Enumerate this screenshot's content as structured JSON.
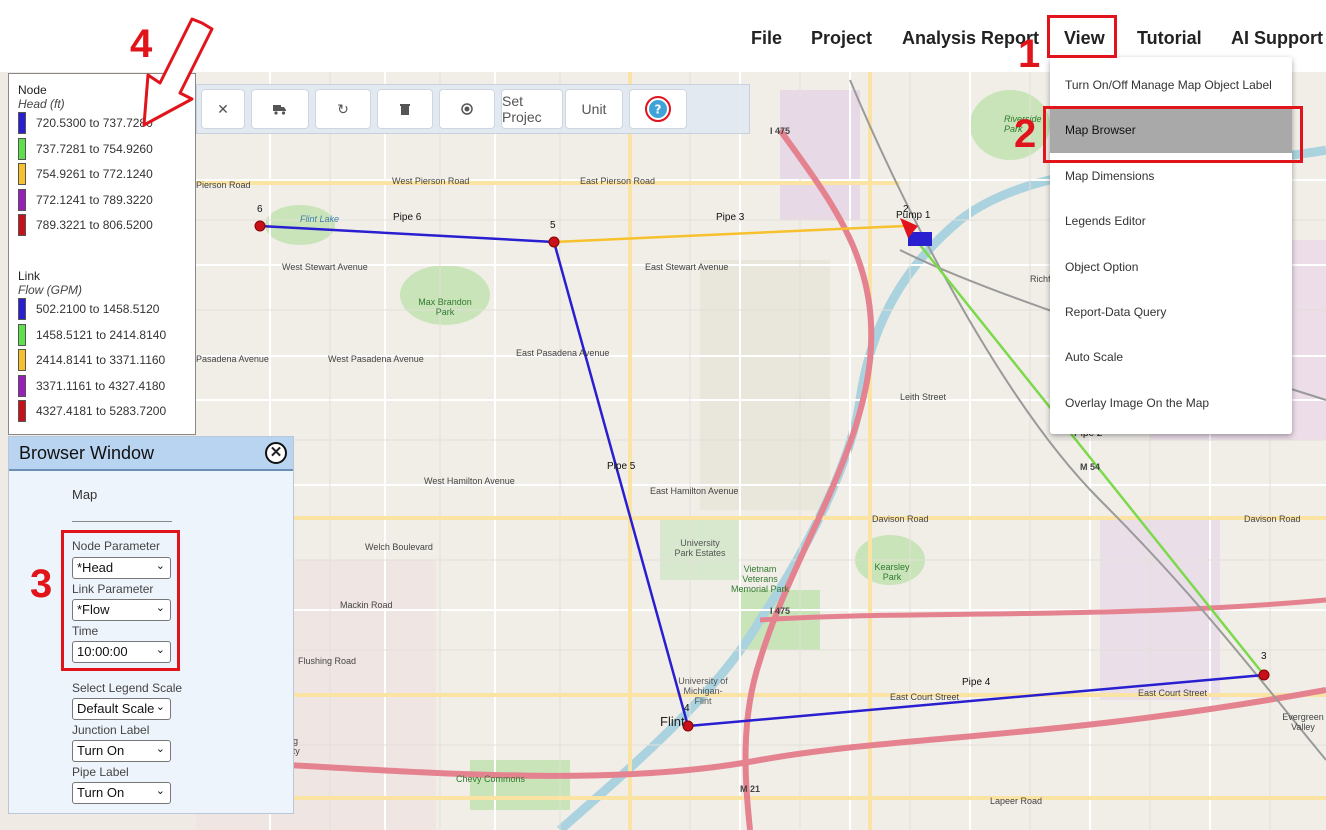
{
  "menu": {
    "file": "File",
    "project": "Project",
    "analysis_report": "Analysis Report",
    "view": "View",
    "tutorial": "Tutorial",
    "ai_support": "AI Support"
  },
  "toolbar": {
    "close_icon": "close-icon",
    "truck_icon": "truck-icon",
    "refresh_icon": "refresh-icon",
    "trash_icon": "trash-icon",
    "record_icon": "record-icon",
    "set_project": "Set Projec",
    "unit": "Unit",
    "help_icon": "help-icon"
  },
  "legend": {
    "node_title": "Node",
    "node_param": "Head (ft)",
    "node_ranges": [
      {
        "label": "720.5300 to 737.7280",
        "color": "#2a1fd0"
      },
      {
        "label": "737.7281 to 754.9260",
        "color": "#5ee04a"
      },
      {
        "label": "754.9261 to 772.1240",
        "color": "#f6c12d"
      },
      {
        "label": "772.1241 to 789.3220",
        "color": "#9a1fb8"
      },
      {
        "label": "789.3221 to 806.5200",
        "color": "#c8101a"
      }
    ],
    "link_title": "Link",
    "link_param": "Flow (GPM)",
    "link_ranges": [
      {
        "label": "502.2100 to 1458.5120",
        "color": "#2a1fd0"
      },
      {
        "label": "1458.5121 to 2414.8140",
        "color": "#5ee04a"
      },
      {
        "label": "2414.8141 to 3371.1160",
        "color": "#f6c12d"
      },
      {
        "label": "3371.1161 to 4327.4180",
        "color": "#9a1fb8"
      },
      {
        "label": "4327.4181 to 5283.7200",
        "color": "#c8101a"
      }
    ]
  },
  "browser": {
    "title": "Browser Window",
    "tab": "Map",
    "node_parameter_label": "Node Parameter",
    "node_parameter_value": "*Head",
    "link_parameter_label": "Link Parameter",
    "link_parameter_value": "*Flow",
    "time_label": "Time",
    "time_value": "10:00:00",
    "legend_scale_label": "Select Legend Scale",
    "legend_scale_value": "Default Scale",
    "junction_label_label": "Junction Label",
    "junction_label_value": "Turn On",
    "pipe_label_label": "Pipe Label",
    "pipe_label_value": "Turn On"
  },
  "view_menu": {
    "items": [
      "Turn On/Off Manage Map Object Label",
      "Map Browser",
      "Map Dimensions",
      "Legends Editor",
      "Object Option",
      "Report-Data Query",
      "Auto Scale",
      "Overlay Image On the Map"
    ],
    "highlight_color": "#a9a9a9"
  },
  "callouts": {
    "one": "1",
    "two": "2",
    "three": "3",
    "four": "4",
    "color": "#e0141a"
  },
  "network": {
    "nodes": [
      "2",
      "3",
      "4",
      "5",
      "6"
    ],
    "pump_label": "Pump 1",
    "pipes": [
      "Pipe 2",
      "Pipe 3",
      "Pipe 4",
      "Pipe 5",
      "Pipe 6"
    ]
  },
  "map_labels": {
    "w_pierson": "West Pierson Road",
    "e_pierson": "East Pierson Road",
    "pierson": "Pierson Road",
    "flint_lake": "Flint Lake",
    "w_stewart": "West Stewart Avenue",
    "e_stewart": "East Stewart Avenue",
    "max_brandon": "Max Brandon Park",
    "pasadena": "Pasadena Avenue",
    "w_pasadena": "West Pasadena Avenue",
    "e_pasadena": "East Pasadena Avenue",
    "w_hamilton": "West Hamilton Avenue",
    "e_hamilton": "East Hamilton Avenue",
    "welch": "Welch Boulevard",
    "university_park": "University Park Estates",
    "vietnam": "Vietnam Veterans Memorial Park",
    "kearsley": "Kearsley Park",
    "davison": "Davison Road",
    "i475": "I 475",
    "flint": "Flint",
    "e_court": "East Court Street",
    "lapeer": "Lapeer Road",
    "richfield": "Richfield Road",
    "leith": "Leith Street",
    "m54": "M 54",
    "m21": "M 21",
    "chevy": "Chevy Commons",
    "kettering": "Kettering University",
    "evergreen": "Evergreen Valley",
    "mackin": "Mackin Road",
    "flushing": "Flushing Road",
    "riverside": "Riverside Park",
    "univ_michigan": "University of Michigan-Flint"
  }
}
